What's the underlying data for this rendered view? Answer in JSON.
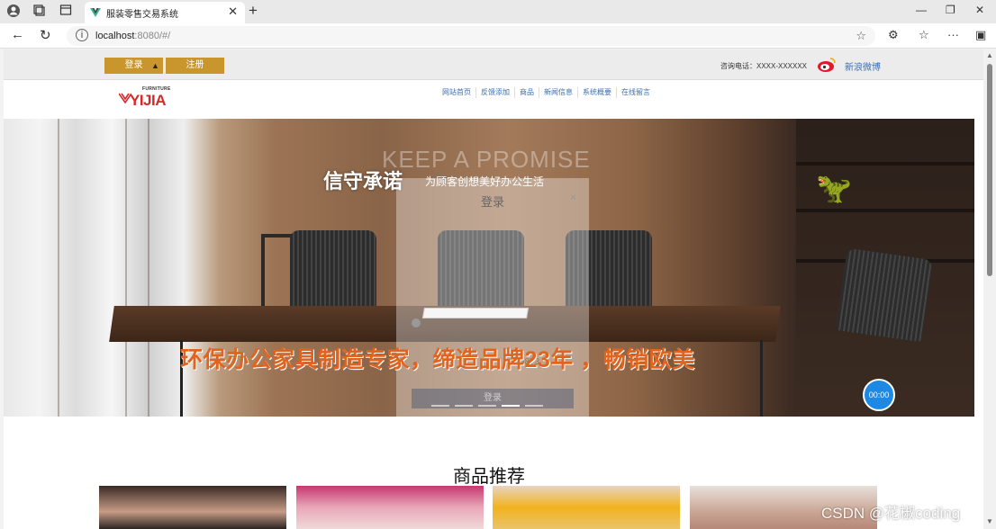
{
  "browser": {
    "tab_title": "服装零售交易系统",
    "url_host": "localhost",
    "url_rest": ":8080/#/",
    "icons": [
      "profile-icon",
      "workspaces-icon",
      "tab-actions-icon",
      "favicon",
      "close-icon",
      "new-tab-icon",
      "minimize-icon",
      "restore-icon",
      "close-window-icon",
      "back-icon",
      "reload-icon",
      "info-icon",
      "favorite-star-icon",
      "extensions-icon",
      "favorites-icon",
      "more-icon",
      "sidebar-icon"
    ]
  },
  "topbar": {
    "login_label": "登录",
    "register_label": "注册",
    "consult": "咨询电话：XXXX-XXXXXX",
    "weibo": "新浪微博"
  },
  "header": {
    "logo_small": "FURNITURE",
    "logo_main": "YIJIA",
    "nav": [
      "网站首页",
      "反馈添加",
      "商品",
      "新闻信息",
      "系统概要",
      "在线留言"
    ]
  },
  "banner": {
    "slogan_main": "信守承诺",
    "slogan_sub": "为顾客创想美好办公生活",
    "slogan_en": "KEEP A PROMISE",
    "headline": "环保办公家具制造专家，缔造品牌23年 ，畅销欧美"
  },
  "modal": {
    "title": "登录",
    "close": "×",
    "ghost_text": "9873",
    "button": "登录"
  },
  "timer": "00:00",
  "section": {
    "title": "商品推荐"
  },
  "watermark": "CSDN @花椒coding",
  "colors": {
    "accent": "#c9962d",
    "nav_link": "#3d6fb0",
    "headline": "#e0641f",
    "timer": "#1e88e5"
  }
}
